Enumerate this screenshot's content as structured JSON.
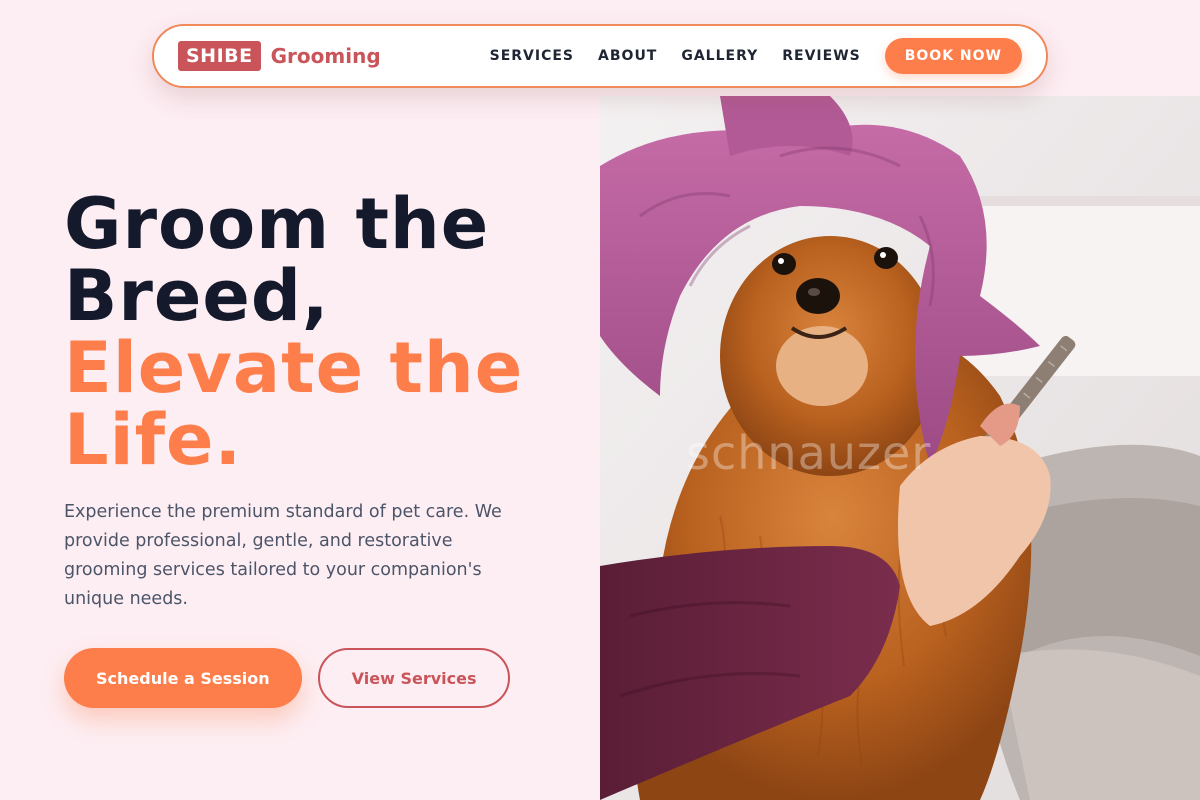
{
  "brand": {
    "badge": "SHIBE",
    "name": "Grooming"
  },
  "nav": {
    "links": [
      "SERVICES",
      "ABOUT",
      "GALLERY",
      "REVIEWS"
    ],
    "cta": "BOOK NOW"
  },
  "hero": {
    "headline_line1": "Groom the",
    "headline_line2": "Breed,",
    "headline_accent_line1": "Elevate the",
    "headline_accent_line2": "Life.",
    "description": "Experience the premium standard of pet care. We provide professional, gentle, and restorative grooming services tailored to your companion's unique needs.",
    "primary_cta": "Schedule a Session",
    "secondary_cta": "View Services",
    "image_watermark": "schnauzer"
  },
  "colors": {
    "accent_orange": "#fd7e4b",
    "brand_red": "#c9555a",
    "page_background": "#fdeef3",
    "headline_dark": "#141a2c"
  },
  "icons": {
    "hero_image": "dog-with-towel-photo"
  }
}
